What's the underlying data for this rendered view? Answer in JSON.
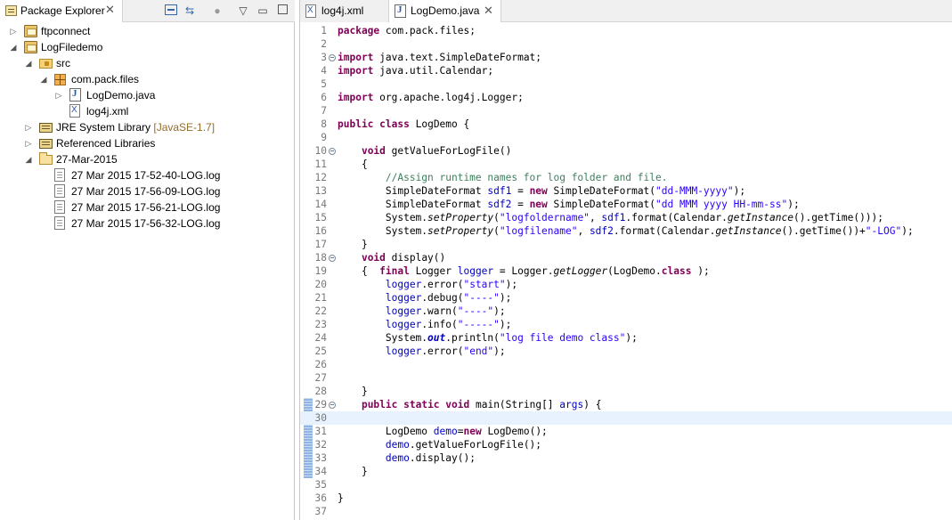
{
  "explorer": {
    "tab_label": "Package Explorer",
    "close_glyph": "✕",
    "toolbar_icons": [
      "collapse-all-icon",
      "link-with-editor-icon",
      "focus-icon",
      "view-menu-icon",
      "minimize-icon",
      "maximize-icon"
    ],
    "items": [
      {
        "label": "ftpconnect",
        "decoration": "",
        "icon": "project-icon",
        "twisty": "▷"
      },
      {
        "label": "LogFiledemo",
        "decoration": "",
        "icon": "project-icon",
        "twisty": "◢"
      },
      {
        "label": "src",
        "decoration": "",
        "icon": "source-folder-icon",
        "twisty": "◢"
      },
      {
        "label": "com.pack.files",
        "decoration": "",
        "icon": "package-icon",
        "twisty": "◢"
      },
      {
        "label": "LogDemo.java",
        "decoration": "",
        "icon": "java-file-icon",
        "twisty": "▷"
      },
      {
        "label": "log4j.xml",
        "decoration": "",
        "icon": "xml-file-icon",
        "twisty": ""
      },
      {
        "label": "JRE System Library",
        "decoration": "[JavaSE-1.7]",
        "icon": "library-icon",
        "twisty": "▷"
      },
      {
        "label": "Referenced Libraries",
        "decoration": "",
        "icon": "library-icon",
        "twisty": "▷"
      },
      {
        "label": "27-Mar-2015",
        "decoration": "",
        "icon": "folder-icon",
        "twisty": "◢"
      },
      {
        "label": "27 Mar 2015 17-52-40-LOG.log",
        "decoration": "",
        "icon": "file-icon",
        "twisty": ""
      },
      {
        "label": "27 Mar 2015 17-56-09-LOG.log",
        "decoration": "",
        "icon": "file-icon",
        "twisty": ""
      },
      {
        "label": "27 Mar 2015 17-56-21-LOG.log",
        "decoration": "",
        "icon": "file-icon",
        "twisty": ""
      },
      {
        "label": "27 Mar 2015 17-56-32-LOG.log",
        "decoration": "",
        "icon": "file-icon",
        "twisty": ""
      }
    ]
  },
  "editor": {
    "tabs": [
      {
        "label": "log4j.xml",
        "active": false
      },
      {
        "label": "LogDemo.java",
        "active": true
      }
    ],
    "close_glyph": "✕",
    "current_line": 30,
    "lines": [
      {
        "n": "1",
        "fold": false,
        "tokens": [
          [
            "kw",
            "package"
          ],
          [
            "",
            "com.pack.files;"
          ]
        ]
      },
      {
        "n": "2",
        "fold": false,
        "tokens": []
      },
      {
        "n": "3",
        "fold": true,
        "tokens": [
          [
            "kw",
            "import"
          ],
          [
            "",
            "java.text.SimpleDateFormat;"
          ]
        ]
      },
      {
        "n": "4",
        "fold": false,
        "tokens": [
          [
            "kw",
            "import"
          ],
          [
            "",
            "java.util.Calendar;"
          ]
        ]
      },
      {
        "n": "5",
        "fold": false,
        "tokens": []
      },
      {
        "n": "6",
        "fold": false,
        "tokens": [
          [
            "kw",
            "import"
          ],
          [
            "",
            "org.apache.log4j.Logger;"
          ]
        ]
      },
      {
        "n": "7",
        "fold": false,
        "tokens": []
      },
      {
        "n": "8",
        "fold": false,
        "tokens": [
          [
            "kw",
            "public"
          ],
          [
            "kw",
            "class"
          ],
          [
            "",
            "LogDemo {"
          ]
        ]
      },
      {
        "n": "9",
        "fold": false,
        "tokens": []
      },
      {
        "n": "10",
        "fold": true,
        "tokens": [
          [
            "",
            "    "
          ],
          [
            "kw",
            "void"
          ],
          [
            "",
            " getValueForLogFile()"
          ]
        ]
      },
      {
        "n": "11",
        "fold": false,
        "tokens": [
          [
            "",
            "    {"
          ]
        ]
      },
      {
        "n": "12",
        "fold": false,
        "tokens": [
          [
            "",
            "        "
          ],
          [
            "cmt",
            "//Assign runtime names for log folder and file."
          ]
        ]
      },
      {
        "n": "13",
        "fold": false,
        "tokens": [
          [
            "",
            "        SimpleDateFormat "
          ],
          [
            "fld",
            "sdf1"
          ],
          [
            "",
            " = "
          ],
          [
            "kw",
            "new"
          ],
          [
            "",
            " SimpleDateFormat("
          ],
          [
            "str",
            "\"dd-MMM-yyyy\""
          ],
          [
            "",
            ");"
          ]
        ]
      },
      {
        "n": "14",
        "fold": false,
        "tokens": [
          [
            "",
            "        SimpleDateFormat "
          ],
          [
            "fld",
            "sdf2"
          ],
          [
            "",
            " = "
          ],
          [
            "kw",
            "new"
          ],
          [
            "",
            " SimpleDateFormat("
          ],
          [
            "str",
            "\"dd MMM yyyy HH-mm-ss\""
          ],
          [
            "",
            ");"
          ]
        ]
      },
      {
        "n": "15",
        "fold": false,
        "tokens": [
          [
            "",
            "        System."
          ],
          [
            "stat",
            "setProperty"
          ],
          [
            "",
            "("
          ],
          [
            "str",
            "\"logfoldername\""
          ],
          [
            "",
            ", "
          ],
          [
            "fld",
            "sdf1"
          ],
          [
            "",
            ".format(Calendar."
          ],
          [
            "stat",
            "getInstance"
          ],
          [
            "",
            "().getTime()));"
          ]
        ]
      },
      {
        "n": "16",
        "fold": false,
        "tokens": [
          [
            "",
            "        System."
          ],
          [
            "stat",
            "setProperty"
          ],
          [
            "",
            "("
          ],
          [
            "str",
            "\"logfilename\""
          ],
          [
            "",
            ", "
          ],
          [
            "fld",
            "sdf2"
          ],
          [
            "",
            ".format(Calendar."
          ],
          [
            "stat",
            "getInstance"
          ],
          [
            "",
            "().getTime())+"
          ],
          [
            "str",
            "\"-LOG\""
          ],
          [
            "",
            ");"
          ]
        ]
      },
      {
        "n": "17",
        "fold": false,
        "tokens": [
          [
            "",
            "    }"
          ]
        ]
      },
      {
        "n": "18",
        "fold": true,
        "tokens": [
          [
            "",
            "    "
          ],
          [
            "kw",
            "void"
          ],
          [
            "",
            " display()"
          ]
        ]
      },
      {
        "n": "19",
        "fold": false,
        "tokens": [
          [
            "",
            "    {  "
          ],
          [
            "kw",
            "final"
          ],
          [
            "",
            " Logger "
          ],
          [
            "fld",
            "logger"
          ],
          [
            "",
            " = Logger."
          ],
          [
            "stat",
            "getLogger"
          ],
          [
            "",
            "(LogDemo."
          ],
          [
            "kw",
            "class"
          ],
          [
            "",
            ");"
          ]
        ]
      },
      {
        "n": "20",
        "fold": false,
        "tokens": [
          [
            "",
            "        "
          ],
          [
            "fld",
            "logger"
          ],
          [
            "",
            ".error("
          ],
          [
            "str",
            "\"start\""
          ],
          [
            "",
            ");"
          ]
        ]
      },
      {
        "n": "21",
        "fold": false,
        "tokens": [
          [
            "",
            "        "
          ],
          [
            "fld",
            "logger"
          ],
          [
            "",
            ".debug("
          ],
          [
            "str",
            "\"----\""
          ],
          [
            "",
            ");"
          ]
        ]
      },
      {
        "n": "22",
        "fold": false,
        "tokens": [
          [
            "",
            "        "
          ],
          [
            "fld",
            "logger"
          ],
          [
            "",
            ".warn("
          ],
          [
            "str",
            "\"----\""
          ],
          [
            "",
            ");"
          ]
        ]
      },
      {
        "n": "23",
        "fold": false,
        "tokens": [
          [
            "",
            "        "
          ],
          [
            "fld",
            "logger"
          ],
          [
            "",
            ".info("
          ],
          [
            "str",
            "\"-----\""
          ],
          [
            "",
            ");"
          ]
        ]
      },
      {
        "n": "24",
        "fold": false,
        "tokens": [
          [
            "",
            "        System."
          ],
          [
            "sfld",
            "out"
          ],
          [
            "",
            ".println("
          ],
          [
            "str",
            "\"log file demo class\""
          ],
          [
            "",
            ");"
          ]
        ]
      },
      {
        "n": "25",
        "fold": false,
        "tokens": [
          [
            "",
            "        "
          ],
          [
            "fld",
            "logger"
          ],
          [
            "",
            ".error("
          ],
          [
            "str",
            "\"end\""
          ],
          [
            "",
            ");"
          ]
        ]
      },
      {
        "n": "26",
        "fold": false,
        "tokens": []
      },
      {
        "n": "27",
        "fold": false,
        "tokens": []
      },
      {
        "n": "28",
        "fold": false,
        "tokens": [
          [
            "",
            "    }"
          ]
        ]
      },
      {
        "n": "29",
        "fold": true,
        "tokens": [
          [
            "",
            "    "
          ],
          [
            "kw",
            "public"
          ],
          [
            "kw",
            "static"
          ],
          [
            "kw",
            "void"
          ],
          [
            "",
            " main(String[] "
          ],
          [
            "fld",
            "args"
          ],
          [
            "",
            ") {"
          ]
        ]
      },
      {
        "n": "30",
        "fold": false,
        "tokens": []
      },
      {
        "n": "31",
        "fold": false,
        "tokens": [
          [
            "",
            "        LogDemo "
          ],
          [
            "fld",
            "demo"
          ],
          [
            "",
            "="
          ],
          [
            "kw",
            "new"
          ],
          [
            "",
            " LogDemo();"
          ]
        ]
      },
      {
        "n": "32",
        "fold": false,
        "tokens": [
          [
            "",
            "        "
          ],
          [
            "fld",
            "demo"
          ],
          [
            "",
            ".getValueForLogFile();"
          ]
        ]
      },
      {
        "n": "33",
        "fold": false,
        "tokens": [
          [
            "",
            "        "
          ],
          [
            "fld",
            "demo"
          ],
          [
            "",
            ".display();"
          ]
        ]
      },
      {
        "n": "34",
        "fold": false,
        "tokens": [
          [
            "",
            "    }"
          ]
        ]
      },
      {
        "n": "35",
        "fold": false,
        "tokens": []
      },
      {
        "n": "36",
        "fold": false,
        "tokens": [
          [
            "",
            "}"
          ]
        ]
      },
      {
        "n": "37",
        "fold": false,
        "tokens": []
      }
    ]
  }
}
